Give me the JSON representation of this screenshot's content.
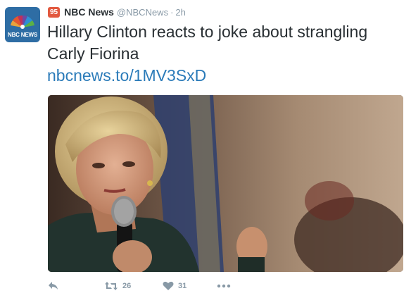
{
  "account": {
    "display_name": "NBC News",
    "username": "@NBCNews",
    "separator": "·",
    "timestamp": "2h",
    "badge": "95",
    "avatar_text": "NBC NEWS"
  },
  "tweet": {
    "text": "Hillary Clinton reacts to joke about strangling Carly Fiorina",
    "link": "nbcnews.to/1MV3SxD"
  },
  "actions": {
    "retweet_count": "26",
    "like_count": "31"
  },
  "icons": {
    "reply": "reply-icon",
    "retweet": "retweet-icon",
    "like": "heart-icon",
    "more": "more-icon"
  },
  "colors": {
    "link": "#2b7bb9",
    "muted": "#8899a6",
    "text": "#292f33",
    "badge": "#e2583e",
    "avatar_bg": "#2e6da4"
  }
}
